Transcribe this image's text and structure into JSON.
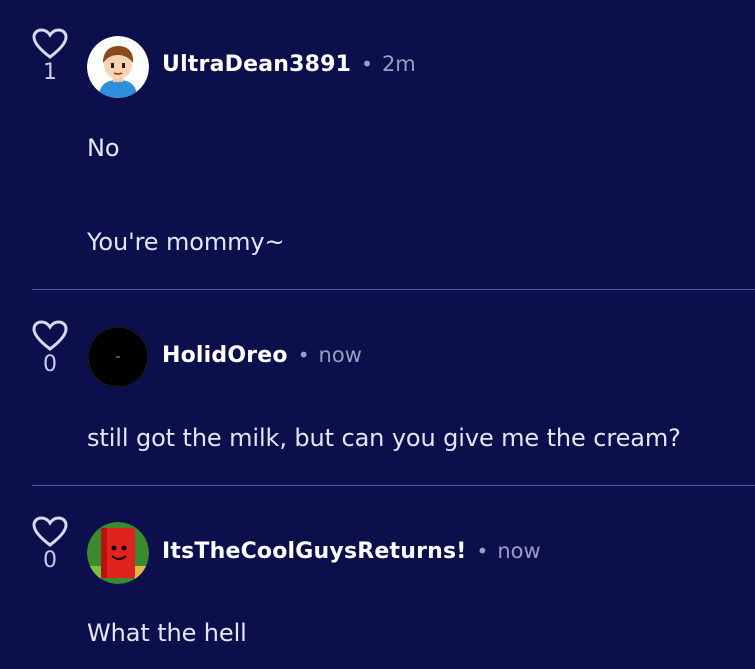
{
  "comments": [
    {
      "likes": "1",
      "username": "UltraDean3891",
      "separator": "•",
      "time": "2m",
      "lines": [
        "No",
        "You're mommy~"
      ],
      "avatar": "cartoon-boy-avatar"
    },
    {
      "likes": "0",
      "username": "HolidOreo",
      "separator": "•",
      "time": "now",
      "lines": [
        "still got the milk, but can you give me the cream?"
      ],
      "avatar": "black-circle-avatar"
    },
    {
      "likes": "0",
      "username": "ItsTheCoolGuysReturns!",
      "separator": "•",
      "time": "now",
      "lines": [
        "What the hell"
      ],
      "avatar": "red-block-avatar"
    }
  ],
  "colors": {
    "background": "#0b0f4b",
    "divider": "#4f5596",
    "muted": "#9a9cc4"
  }
}
